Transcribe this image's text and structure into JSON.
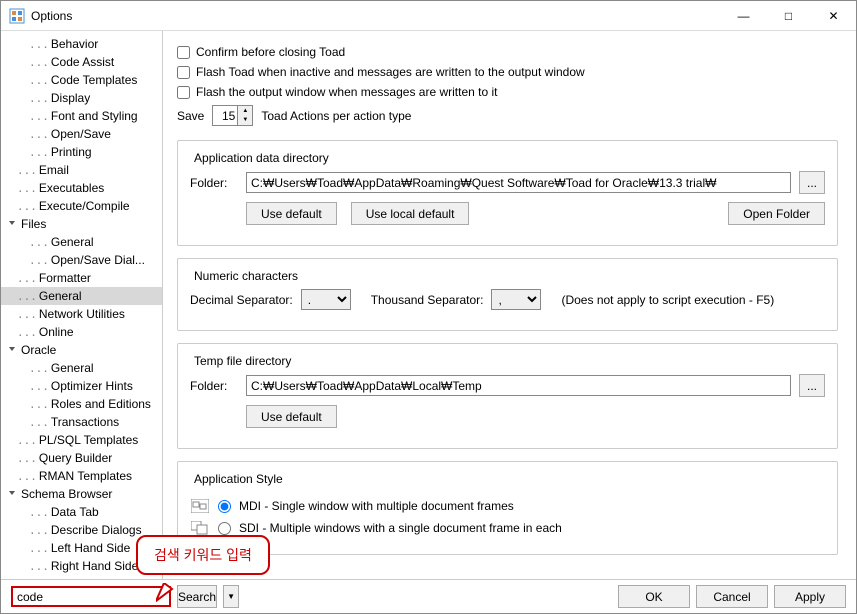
{
  "window": {
    "title": "Options"
  },
  "winbtns": {
    "min": "—",
    "max": "□",
    "close": "✕"
  },
  "tree": [
    {
      "indent": 2,
      "toggle": "",
      "label": "Behavior"
    },
    {
      "indent": 2,
      "toggle": "",
      "label": "Code Assist"
    },
    {
      "indent": 2,
      "toggle": "",
      "label": "Code Templates"
    },
    {
      "indent": 2,
      "toggle": "",
      "label": "Display"
    },
    {
      "indent": 2,
      "toggle": "",
      "label": "Font and Styling"
    },
    {
      "indent": 2,
      "toggle": "",
      "label": "Open/Save"
    },
    {
      "indent": 2,
      "toggle": "",
      "label": "Printing"
    },
    {
      "indent": 1,
      "toggle": "",
      "label": "Email"
    },
    {
      "indent": 1,
      "toggle": "",
      "label": "Executables"
    },
    {
      "indent": 1,
      "toggle": "",
      "label": "Execute/Compile"
    },
    {
      "indent": 0,
      "toggle": "v",
      "label": "Files"
    },
    {
      "indent": 2,
      "toggle": "",
      "label": "General"
    },
    {
      "indent": 2,
      "toggle": "",
      "label": "Open/Save Dial..."
    },
    {
      "indent": 1,
      "toggle": "",
      "label": "Formatter"
    },
    {
      "indent": 1,
      "toggle": "",
      "label": "General",
      "selected": true
    },
    {
      "indent": 1,
      "toggle": "",
      "label": "Network Utilities"
    },
    {
      "indent": 1,
      "toggle": "",
      "label": "Online"
    },
    {
      "indent": 0,
      "toggle": "v",
      "label": "Oracle"
    },
    {
      "indent": 2,
      "toggle": "",
      "label": "General"
    },
    {
      "indent": 2,
      "toggle": "",
      "label": "Optimizer Hints"
    },
    {
      "indent": 2,
      "toggle": "",
      "label": "Roles and Editions"
    },
    {
      "indent": 2,
      "toggle": "",
      "label": "Transactions"
    },
    {
      "indent": 1,
      "toggle": "",
      "label": "PL/SQL Templates"
    },
    {
      "indent": 1,
      "toggle": "",
      "label": "Query Builder"
    },
    {
      "indent": 1,
      "toggle": "",
      "label": "RMAN Templates"
    },
    {
      "indent": 0,
      "toggle": "v",
      "label": "Schema Browser"
    },
    {
      "indent": 2,
      "toggle": "",
      "label": "Data Tab"
    },
    {
      "indent": 2,
      "toggle": "",
      "label": "Describe Dialogs"
    },
    {
      "indent": 2,
      "toggle": "",
      "label": "Left Hand Side"
    },
    {
      "indent": 2,
      "toggle": "",
      "label": "Right Hand Side"
    }
  ],
  "checks": {
    "confirm": "Confirm before closing Toad",
    "flash_inactive": "Flash Toad when inactive and messages are written to the output window",
    "flash_output": "Flash the output window when messages are written to it"
  },
  "save": {
    "label": "Save",
    "value": "15",
    "suffix": "Toad Actions per action type"
  },
  "appdata": {
    "legend": "Application data directory",
    "folder_label": "Folder:",
    "folder_value": "C:₩Users₩Toad₩AppData₩Roaming₩Quest Software₩Toad for Oracle₩13.3 trial₩",
    "browse": "...",
    "use_default": "Use default",
    "use_local": "Use local default",
    "open_folder": "Open Folder"
  },
  "numeric": {
    "legend": "Numeric characters",
    "decimal_label": "Decimal Separator:",
    "decimal_value": ".",
    "thousand_label": "Thousand Separator:",
    "thousand_value": ",",
    "note": "(Does not apply to script execution - F5)"
  },
  "temp": {
    "legend": "Temp file directory",
    "folder_label": "Folder:",
    "folder_value": "C:₩Users₩Toad₩AppData₩Local₩Temp",
    "browse": "...",
    "use_default": "Use default"
  },
  "appstyle": {
    "legend": "Application Style",
    "mdi": "MDI - Single window with multiple document frames",
    "sdi": "SDI - Multiple windows with a single document frame in each"
  },
  "footer": {
    "search_value": "code",
    "search_btn": "Search",
    "ok": "OK",
    "cancel": "Cancel",
    "apply": "Apply"
  },
  "callout": {
    "text": "검색 키워드 입력"
  }
}
